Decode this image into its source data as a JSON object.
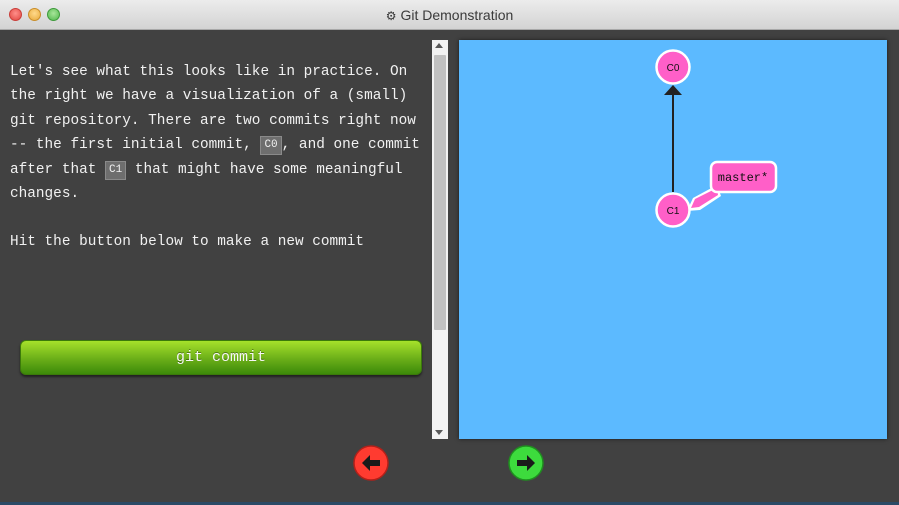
{
  "window": {
    "title": "Git Demonstration"
  },
  "instructions": {
    "paragraph_before_c0": "Let's see what this looks like in practice. On the right we have a visualization of a (small) git repository. There are two commits right now -- the first initial commit, ",
    "c0_code": "C0",
    "paragraph_between": ", and one commit after that ",
    "c1_code": "C1",
    "paragraph_after_c1": " that might have some meaningful changes.",
    "hint": "Hit the button below to make a new commit"
  },
  "buttons": {
    "commit_label": "git commit"
  },
  "graph": {
    "commits": [
      {
        "id": "C0",
        "color": "#ff5fc8"
      },
      {
        "id": "C1",
        "color": "#ff5fc8"
      }
    ],
    "branch": {
      "label": "master*",
      "color": "#ff5fc8"
    },
    "background": "#5cbaff"
  },
  "nav": {
    "back_icon": "left-arrow-icon",
    "back_color": "#ff3b30",
    "forward_icon": "right-arrow-icon",
    "forward_color": "#3ddb3d"
  }
}
